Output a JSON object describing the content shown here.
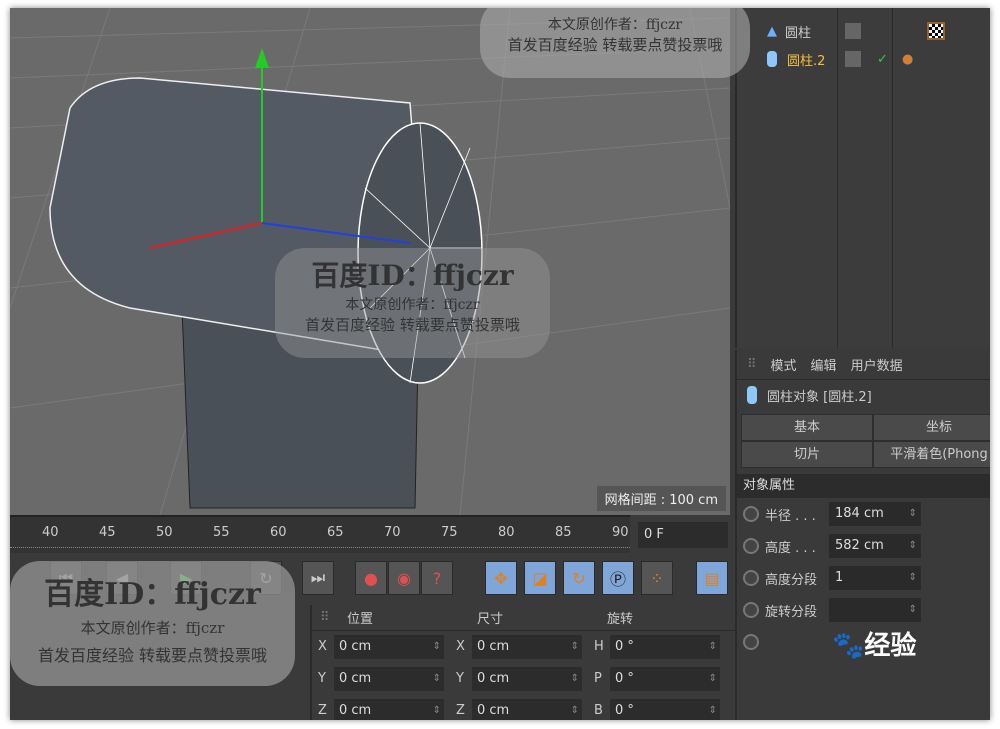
{
  "viewport": {
    "grid_spacing_label": "网格间距 : 100 cm"
  },
  "object_manager": {
    "objects": [
      {
        "name": "圆柱",
        "icon": "cone-icon",
        "active": false
      },
      {
        "name": "圆柱.2",
        "icon": "cylinder-icon",
        "active": true,
        "check": "✓"
      }
    ]
  },
  "attributes": {
    "menu": [
      "模式",
      "编辑",
      "用户数据"
    ],
    "object_title": "圆柱对象 [圆柱.2]",
    "tabs": [
      "基本",
      "坐标",
      "切片",
      "平滑着色(Phong"
    ],
    "section": "对象属性",
    "props": [
      {
        "label": "半径 . . .",
        "value": "184 cm"
      },
      {
        "label": "高度 . . .",
        "value": "582 cm"
      },
      {
        "label": "高度分段",
        "value": "1"
      },
      {
        "label": "旋转分段",
        "value": ""
      }
    ]
  },
  "timeline": {
    "ticks": [
      "40",
      "45",
      "50",
      "55",
      "60",
      "65",
      "70",
      "75",
      "80",
      "85",
      "90"
    ],
    "current_frame": "0 F"
  },
  "coordinates": {
    "headers": [
      "位置",
      "尺寸",
      "旋转"
    ],
    "rows": [
      {
        "pl": "X",
        "p": "0 cm",
        "sl": "X",
        "s": "0 cm",
        "rl": "H",
        "r": "0 °"
      },
      {
        "pl": "Y",
        "p": "0 cm",
        "sl": "Y",
        "s": "0 cm",
        "rl": "P",
        "r": "0 °"
      },
      {
        "pl": "Z",
        "p": "0 cm",
        "sl": "Z",
        "s": "0 cm",
        "rl": "B",
        "r": "0 °"
      }
    ]
  },
  "watermark": {
    "id": "百度ID：ffjczr",
    "author": "本文原创作者：ffjczr",
    "note": "首发百度经验 转载要点赞投票哦",
    "logo": "经验"
  },
  "colors": {
    "accent_blue": "#7fa6d9",
    "active_object": "#f0c040",
    "record_red": "#e05050"
  }
}
